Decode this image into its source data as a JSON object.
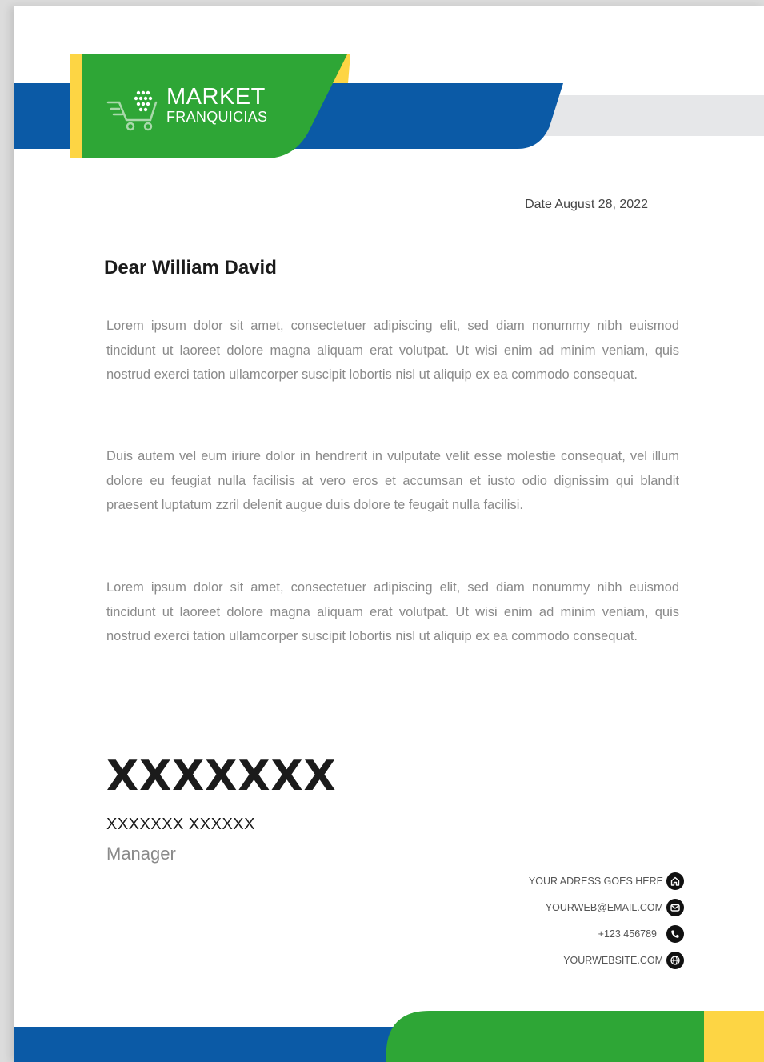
{
  "brand": {
    "name_top": "MARKET",
    "name_bottom": "FRANQUICIAS"
  },
  "colors": {
    "blue": "#0b5aa6",
    "green": "#2ea636",
    "yellow": "#fdd544",
    "gray": "#e6e7e9"
  },
  "letter": {
    "date": "Date August 28, 2022",
    "greeting": "Dear William David",
    "paragraphs": [
      "Lorem ipsum dolor sit amet, consectetuer adipiscing elit, sed diam nonummy nibh euismod tincidunt ut laoreet dolore magna aliquam erat volutpat. Ut wisi enim ad minim veniam, quis nostrud exerci tation ullamcorper suscipit lobortis nisl ut aliquip ex ea commodo consequat.",
      "Duis autem vel eum iriure dolor in hendrerit in vulputate velit esse molestie consequat, vel illum dolore eu feugiat nulla facilisis at vero eros et accumsan et iusto odio dignissim qui blandit praesent luptatum zzril delenit augue duis dolore te feugait nulla facilisi.",
      "Lorem ipsum dolor sit amet, consectetuer adipiscing elit, sed diam nonummy nibh euismod tincidunt ut laoreet dolore magna aliquam erat volutpat. Ut wisi enim ad minim veniam, quis nostrud exerci tation ullamcorper suscipit lobortis nisl ut aliquip ex ea commodo consequat."
    ],
    "signature": "XXXXXXX",
    "signer_name": "XXXXXXX XXXXXX",
    "signer_role": "Manager"
  },
  "contacts": [
    {
      "text": "YOUR ADRESS GOES HERE",
      "icon": "home-icon"
    },
    {
      "text": "YOURWEB@EMAIL.COM",
      "icon": "mail-icon"
    },
    {
      "text": "+123 456789",
      "icon": "phone-icon"
    },
    {
      "text": "YOURWEBSITE.COM",
      "icon": "globe-icon"
    }
  ]
}
